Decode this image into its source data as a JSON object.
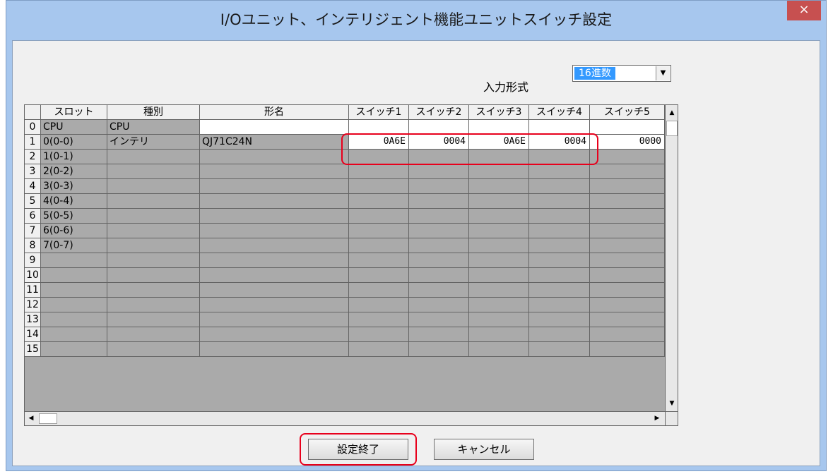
{
  "window": {
    "title": "I/Oユニット、インテリジェント機能ユニットスイッチ設定",
    "close_label": "×"
  },
  "input_format": {
    "label": "入力形式",
    "selected": "16進数",
    "dropdown_glyph": "▼"
  },
  "table": {
    "columns": [
      "",
      "スロット",
      "種別",
      "形名",
      "スイッチ1",
      "スイッチ2",
      "スイッチ3",
      "スイッチ4",
      "スイッチ5"
    ],
    "rows": [
      [
        "0",
        "CPU",
        "CPU",
        "",
        "",
        "",
        "",
        "",
        ""
      ],
      [
        "1",
        "0(0-0)",
        "インテリ",
        "QJ71C24N",
        "0A6E",
        "0004",
        "0A6E",
        "0004",
        "0000"
      ],
      [
        "2",
        "1(0-1)",
        "",
        "",
        "",
        "",
        "",
        "",
        ""
      ],
      [
        "3",
        "2(0-2)",
        "",
        "",
        "",
        "",
        "",
        "",
        ""
      ],
      [
        "4",
        "3(0-3)",
        "",
        "",
        "",
        "",
        "",
        "",
        ""
      ],
      [
        "5",
        "4(0-4)",
        "",
        "",
        "",
        "",
        "",
        "",
        ""
      ],
      [
        "6",
        "5(0-5)",
        "",
        "",
        "",
        "",
        "",
        "",
        ""
      ],
      [
        "7",
        "6(0-6)",
        "",
        "",
        "",
        "",
        "",
        "",
        ""
      ],
      [
        "8",
        "7(0-7)",
        "",
        "",
        "",
        "",
        "",
        "",
        ""
      ],
      [
        "9",
        "",
        "",
        "",
        "",
        "",
        "",
        "",
        ""
      ],
      [
        "10",
        "",
        "",
        "",
        "",
        "",
        "",
        "",
        ""
      ],
      [
        "11",
        "",
        "",
        "",
        "",
        "",
        "",
        "",
        ""
      ],
      [
        "12",
        "",
        "",
        "",
        "",
        "",
        "",
        "",
        ""
      ],
      [
        "13",
        "",
        "",
        "",
        "",
        "",
        "",
        "",
        ""
      ],
      [
        "14",
        "",
        "",
        "",
        "",
        "",
        "",
        "",
        ""
      ],
      [
        "15",
        "",
        "",
        "",
        "",
        "",
        "",
        "",
        ""
      ]
    ],
    "scroll_glyphs": {
      "up": "▲",
      "down": "▼",
      "left": "◀",
      "right": "▶"
    }
  },
  "buttons": {
    "ok": "設定終了",
    "cancel": "キャンセル"
  },
  "colors": {
    "highlight": "#e8001c",
    "selection": "#3399ff",
    "close": "#c75050",
    "frame": "#a7c7ee"
  }
}
